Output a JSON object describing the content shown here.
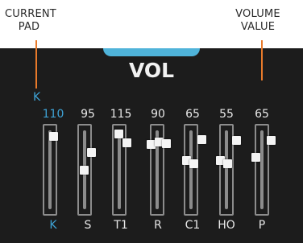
{
  "annotations": {
    "current_pad": [
      "CURRENT",
      "PAD"
    ],
    "volume_value": [
      "VOLUME",
      "VALUE"
    ],
    "pointer_color": "#e87a2a"
  },
  "screen": {
    "title": "VOL",
    "current_pad_display": "K",
    "accent": "#3ea3d6",
    "tab_color": "#4fb3d9",
    "background": "#1c1c1c"
  },
  "pads": [
    {
      "label": "K",
      "value": "110",
      "active": true
    },
    {
      "label": "S",
      "value": "95",
      "active": false
    },
    {
      "label": "T1",
      "value": "115",
      "active": false
    },
    {
      "label": "R",
      "value": "90",
      "active": false
    },
    {
      "label": "C1",
      "value": "65",
      "active": false
    },
    {
      "label": "HO",
      "value": "55",
      "active": false
    },
    {
      "label": "P",
      "value": "65",
      "active": false
    }
  ]
}
